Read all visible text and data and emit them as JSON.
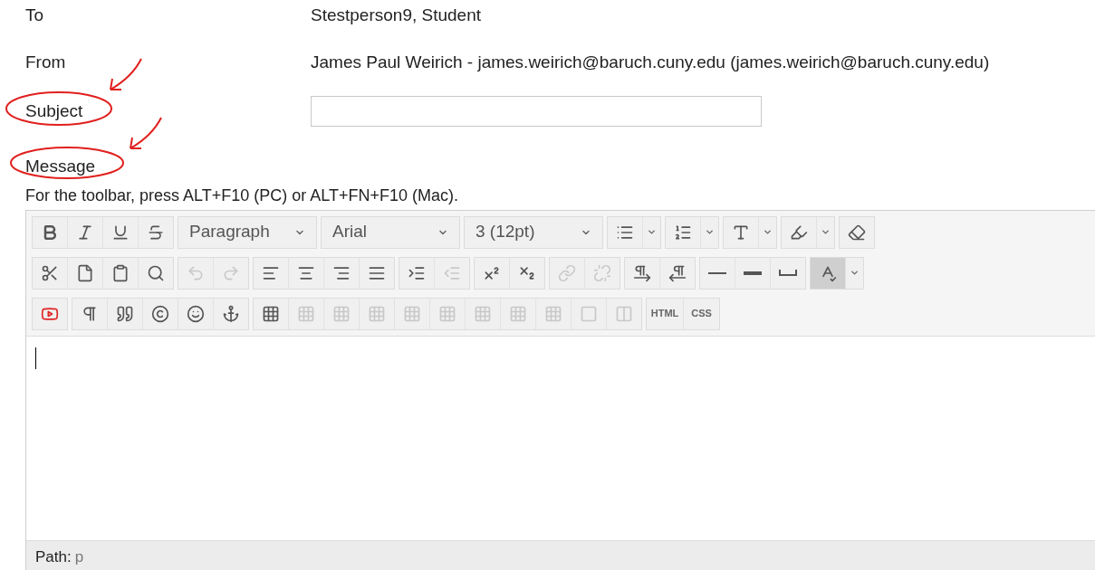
{
  "fields": [
    {
      "label": "To",
      "value": "Stestperson9, Student",
      "kind": "text"
    },
    {
      "label": "From",
      "value": "James Paul Weirich - james.weirich@baruch.cuny.edu (james.weirich@baruch.cuny.edu)",
      "kind": "text"
    },
    {
      "label": "Subject",
      "kind": "input",
      "annotated": true
    }
  ],
  "message": {
    "label": "Message",
    "annotated": true,
    "hint": "For the toolbar, press ALT+F10 (PC) or ALT+FN+F10 (Mac)."
  },
  "toolbar": {
    "rows": [
      [
        {
          "items": [
            {
              "kind": "bold",
              "disabled": false,
              "pressed": false
            },
            {
              "kind": "italic",
              "disabled": false,
              "pressed": false
            },
            {
              "kind": "underline",
              "disabled": false,
              "pressed": false
            },
            {
              "kind": "strike",
              "disabled": false,
              "pressed": false
            }
          ]
        },
        {
          "items": [
            {
              "kind": "dropdown",
              "value": "Paragraph"
            }
          ]
        },
        {
          "items": [
            {
              "kind": "dropdown",
              "value": "Arial"
            }
          ]
        },
        {
          "items": [
            {
              "kind": "dropdown",
              "value": "3 (12pt)"
            }
          ]
        },
        {
          "items": [
            {
              "kind": "bullets",
              "menu": true,
              "disabled": false,
              "pressed": false
            }
          ]
        },
        {
          "items": [
            {
              "kind": "numbers",
              "menu": true,
              "disabled": false,
              "pressed": false
            }
          ]
        },
        {
          "items": [
            {
              "kind": "textcolor",
              "menu": true,
              "disabled": false,
              "pressed": false
            }
          ]
        },
        {
          "items": [
            {
              "kind": "highlight",
              "menu": true,
              "disabled": false,
              "pressed": false
            }
          ]
        },
        {
          "items": [
            {
              "kind": "eraser",
              "disabled": false,
              "pressed": false
            }
          ]
        }
      ],
      [
        {
          "items": [
            {
              "kind": "cut",
              "disabled": false,
              "pressed": false
            },
            {
              "kind": "copy",
              "disabled": false,
              "pressed": false
            },
            {
              "kind": "paste",
              "disabled": false,
              "pressed": false
            },
            {
              "kind": "find",
              "disabled": false,
              "pressed": false
            }
          ]
        },
        {
          "items": [
            {
              "kind": "undo",
              "disabled": true,
              "pressed": false
            },
            {
              "kind": "redo",
              "disabled": true,
              "pressed": false
            }
          ]
        },
        {
          "items": [
            {
              "kind": "alignleft",
              "disabled": false,
              "pressed": false
            },
            {
              "kind": "aligncenter",
              "disabled": false,
              "pressed": false
            },
            {
              "kind": "alignright",
              "disabled": false,
              "pressed": false
            },
            {
              "kind": "justify",
              "disabled": false,
              "pressed": false
            }
          ]
        },
        {
          "items": [
            {
              "kind": "indent",
              "disabled": false,
              "pressed": false
            },
            {
              "kind": "outdent",
              "disabled": true,
              "pressed": false
            }
          ]
        },
        {
          "items": [
            {
              "kind": "superscript",
              "disabled": false,
              "pressed": false
            },
            {
              "kind": "subscript",
              "disabled": false,
              "pressed": false
            }
          ]
        },
        {
          "items": [
            {
              "kind": "link",
              "disabled": true,
              "pressed": false
            },
            {
              "kind": "unlink",
              "disabled": true,
              "pressed": false
            }
          ]
        },
        {
          "items": [
            {
              "kind": "ltr",
              "disabled": false,
              "pressed": false
            },
            {
              "kind": "rtl",
              "disabled": false,
              "pressed": false
            }
          ]
        },
        {
          "items": [
            {
              "kind": "hr",
              "disabled": false,
              "pressed": false
            },
            {
              "kind": "thickline",
              "disabled": false,
              "pressed": false
            },
            {
              "kind": "space",
              "disabled": false,
              "pressed": false
            }
          ]
        },
        {
          "items": [
            {
              "kind": "spellcheck",
              "menu": true,
              "disabled": false,
              "pressed": true
            }
          ]
        }
      ],
      [
        {
          "items": [
            {
              "kind": "media",
              "disabled": false,
              "pressed": false
            }
          ]
        },
        {
          "items": [
            {
              "kind": "pilcrow",
              "disabled": false,
              "pressed": false
            },
            {
              "kind": "quote",
              "disabled": false,
              "pressed": false
            },
            {
              "kind": "copyright",
              "disabled": false,
              "pressed": false
            },
            {
              "kind": "smile",
              "disabled": false,
              "pressed": false
            },
            {
              "kind": "anchor",
              "disabled": false,
              "pressed": false
            }
          ]
        },
        {
          "items": [
            {
              "kind": "table",
              "disabled": false,
              "pressed": false
            },
            {
              "kind": "tableop",
              "disabled": true,
              "pressed": false
            },
            {
              "kind": "tableop",
              "disabled": true,
              "pressed": false
            },
            {
              "kind": "tableop",
              "disabled": true,
              "pressed": false
            },
            {
              "kind": "tableop",
              "disabled": true,
              "pressed": false
            },
            {
              "kind": "tableop",
              "disabled": true,
              "pressed": false
            },
            {
              "kind": "tableop",
              "disabled": true,
              "pressed": false
            },
            {
              "kind": "tableop",
              "disabled": true,
              "pressed": false
            },
            {
              "kind": "tableop",
              "disabled": true,
              "pressed": false
            },
            {
              "kind": "cell",
              "disabled": true,
              "pressed": false
            },
            {
              "kind": "split",
              "disabled": true,
              "pressed": false
            }
          ]
        },
        {
          "items": [
            {
              "kind": "text",
              "label": "HTML",
              "disabled": false
            },
            {
              "kind": "text",
              "label": "CSS",
              "disabled": false
            }
          ]
        }
      ]
    ]
  },
  "path_bar": {
    "label": "Path:",
    "value": "p"
  }
}
